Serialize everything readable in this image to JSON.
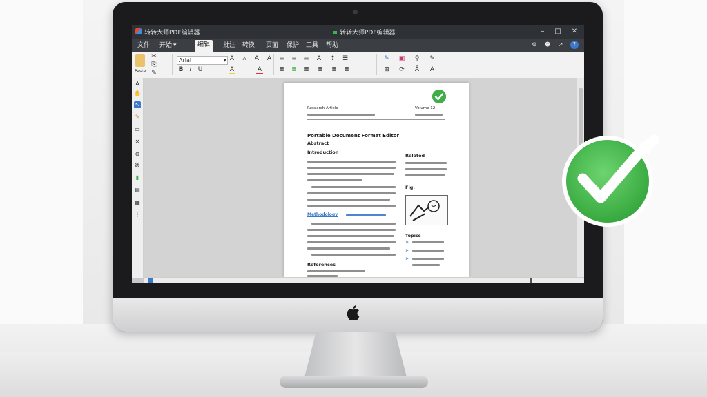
{
  "window": {
    "title_left": "转转大师PDF编辑器",
    "title_center": "转转大师PDF编辑器"
  },
  "menu": {
    "tabs": [
      {
        "label": "文件"
      },
      {
        "label": "开始"
      },
      {
        "label": "编辑"
      },
      {
        "label": "批注"
      },
      {
        "label": "转换"
      },
      {
        "label": "页面"
      },
      {
        "label": "保护"
      },
      {
        "label": "工具"
      },
      {
        "label": "帮助"
      }
    ],
    "active_tab": "编辑"
  },
  "ribbon": {
    "font_name": "Arial",
    "font_size_label": "A",
    "paste_label": "Paste"
  },
  "document": {
    "header_left": "Research Article",
    "header_right": "Volume 12",
    "title": "Portable Document Format Editor",
    "subtitle": "Abstract",
    "section1": "Introduction",
    "side_heading": "Related",
    "figure_caption": "Fig.",
    "link_text": "Methodology",
    "list_heading": "Topics",
    "references": "References"
  },
  "colors": {
    "accent": "#3b78c9",
    "success": "#3fae49",
    "titlebar": "#2e3135"
  }
}
